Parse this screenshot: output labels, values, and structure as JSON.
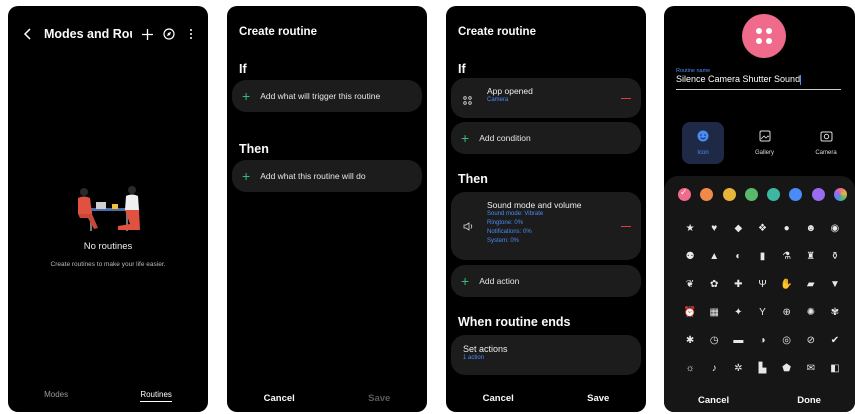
{
  "screen1": {
    "title": "Modes and Rou...",
    "empty_title": "No routines",
    "empty_subtitle": "Create routines to make your life easier.",
    "nav": {
      "modes": "Modes",
      "routines": "Routines"
    }
  },
  "screen2": {
    "title": "Create routine",
    "if_label": "If",
    "if_add": "Add what will trigger this routine",
    "then_label": "Then",
    "then_add": "Add what this routine will do",
    "cancel": "Cancel",
    "save": "Save"
  },
  "screen3": {
    "title": "Create routine",
    "if_label": "If",
    "trigger_title": "App opened",
    "trigger_sub": "Camera",
    "add_condition": "Add condition",
    "then_label": "Then",
    "action_title": "Sound mode and volume",
    "action_details": [
      "Sound mode: Vibrate",
      "Ringtone: 0%",
      "Notifications: 0%",
      "System: 0%"
    ],
    "add_action": "Add action",
    "ends_label": "When routine ends",
    "set_actions": "Set actions",
    "set_actions_sub": "1 action",
    "cancel": "Cancel",
    "save": "Save"
  },
  "screen4": {
    "name_label": "Routine name",
    "name_value": "Silence Camera Shutter Sound",
    "sources": [
      {
        "label": "Icon",
        "icon": "smile-icon"
      },
      {
        "label": "Gallery",
        "icon": "image-icon"
      },
      {
        "label": "Camera",
        "icon": "camera-icon"
      }
    ],
    "colors": [
      "#f06a8c",
      "#f08a4b",
      "#e8b43a",
      "#5ab86a",
      "#3cb8a0",
      "#4a8cf5",
      "#9a6af0",
      "gradient"
    ],
    "icons": [
      "★",
      "♥",
      "◆",
      "❖",
      "●",
      "☻",
      "◉",
      "⚉",
      "▲",
      "◐",
      "▮",
      "⚗",
      "♜",
      "⚱",
      "❦",
      "✿",
      "✚",
      "Ψ",
      "✋",
      "▰",
      "▼",
      "⏰",
      "▦",
      "✦",
      "Y",
      "⊕",
      "✺",
      "✾",
      "✱",
      "◷",
      "▬",
      "◑",
      "◎",
      "⊘",
      "✔",
      "☼",
      "♪",
      "✲",
      "▙",
      "⬟",
      "✉",
      "◧"
    ],
    "cancel": "Cancel",
    "done": "Done"
  }
}
